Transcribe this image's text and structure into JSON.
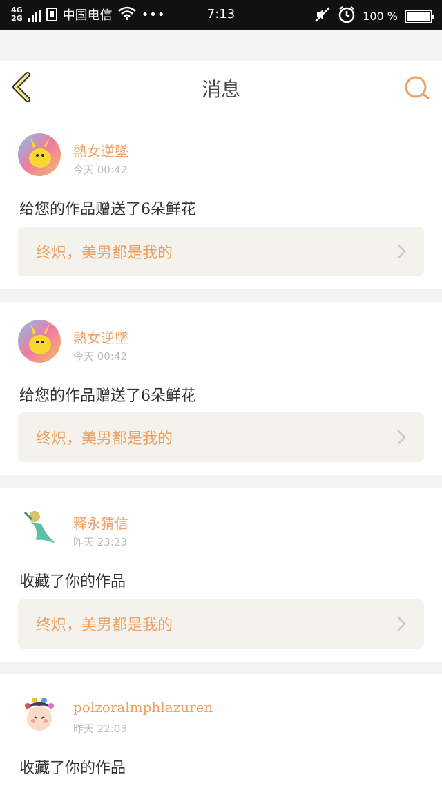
{
  "status_bar": {
    "net_top": "4G",
    "net_bottom": "2G",
    "carrier": "中国电信",
    "wifi_icon": "wifi-icon",
    "more": "•••",
    "time": "7:13",
    "mute_icon": "mute-icon",
    "alarm_icon": "alarm-icon",
    "battery_text": "100 %",
    "battery_level": 1.0
  },
  "header": {
    "title": "消息",
    "back_icon": "chevron-left-icon",
    "search_icon": "search-icon",
    "accent": "#f0a060"
  },
  "items": [
    {
      "username": "熱女逆墜",
      "time": "今天 00:42",
      "message": "给您的作品赠送了6朵鲜花",
      "quote": "终炽，美男都是我的"
    },
    {
      "username": "熱女逆墜",
      "time": "今天 00:42",
      "message": "给您的作品赠送了6朵鲜花",
      "quote": "终炽，美男都是我的"
    },
    {
      "username": "释永猜信",
      "time": "昨天 23:23",
      "message": "收藏了你的作品",
      "quote": "终炽，美男都是我的"
    },
    {
      "username": "polzoralmphlazuren",
      "time": "昨天 22:03",
      "message": "收藏了你的作品"
    }
  ]
}
